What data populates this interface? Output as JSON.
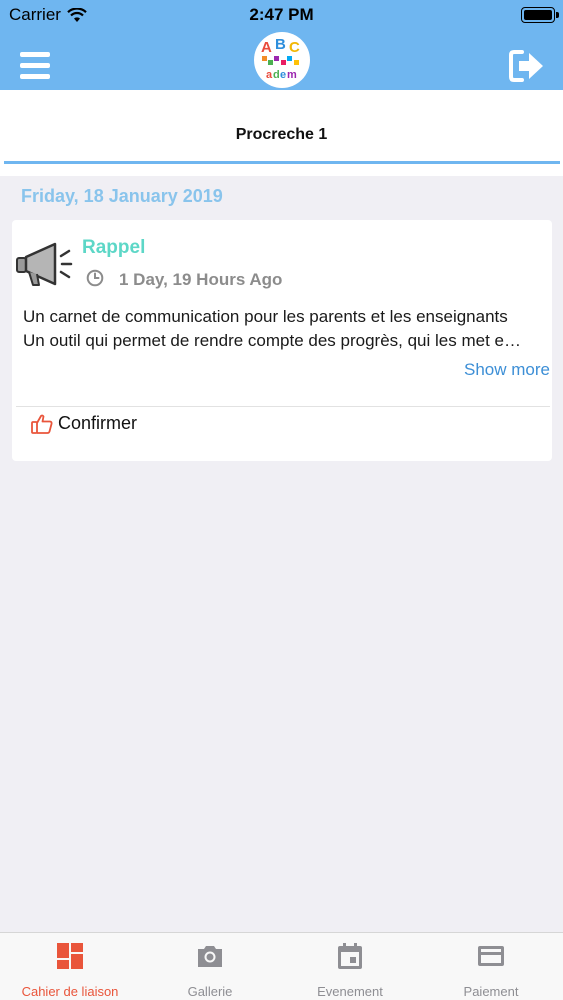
{
  "status_bar": {
    "carrier": "Carrier",
    "time": "2:47 PM"
  },
  "header": {
    "logo_alt": "ABC Academy logo",
    "logo_letters": "ABC",
    "logo_sub": "adem"
  },
  "child_tab": {
    "label": "Procreche  1"
  },
  "feed": {
    "date_heading": "Friday, 18 January 2019",
    "posts": [
      {
        "title": "Rappel",
        "time_ago": "1 Day, 19 Hours Ago",
        "line1": "Un carnet de communication pour les parents et les enseignants",
        "line2": "Un outil qui permet de rendre compte des progrès, qui les met e…",
        "show_more": "Show more",
        "confirm": "Confirmer"
      }
    ]
  },
  "tab_bar": {
    "items": [
      {
        "label": "Cahier de liaison",
        "icon": "dashboard-icon",
        "active": true
      },
      {
        "label": "Gallerie",
        "icon": "camera-icon",
        "active": false
      },
      {
        "label": "Evenement",
        "icon": "calendar-icon",
        "active": false
      },
      {
        "label": "Paiement",
        "icon": "credit-card-icon",
        "active": false
      }
    ]
  },
  "colors": {
    "header": "#6fb6f0",
    "post_title": "#5dd7c7",
    "date_heading": "#89c4ec",
    "link": "#3d8fd6",
    "active_tab": "#e9553b"
  }
}
